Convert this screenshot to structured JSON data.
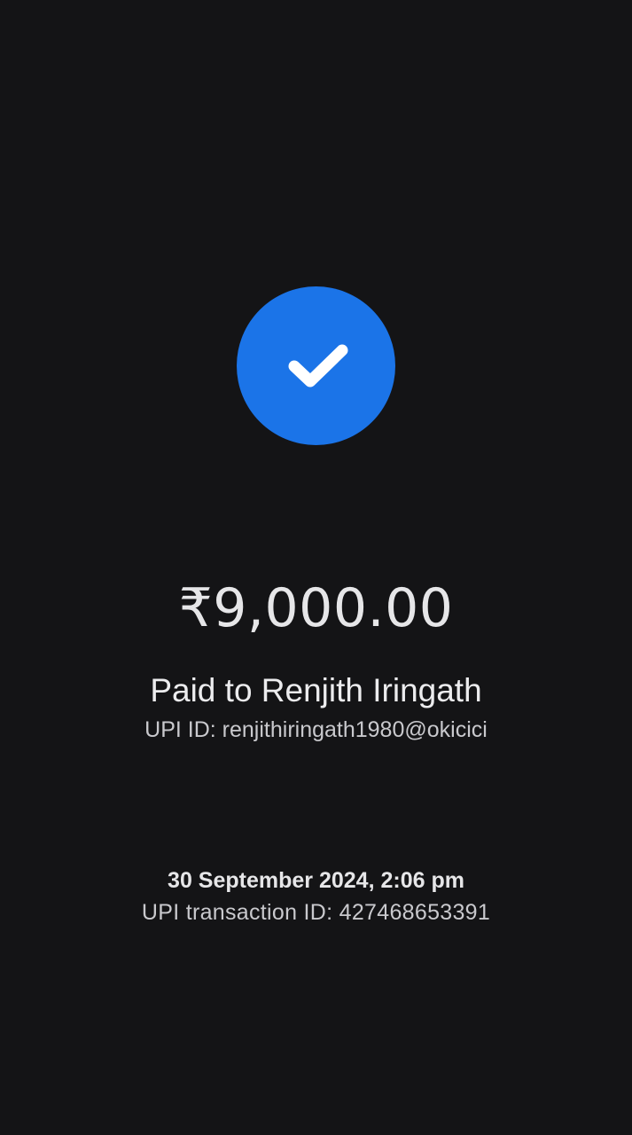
{
  "colors": {
    "background": "#141416",
    "success_circle": "#1b74e8",
    "check_mark": "#ffffff",
    "primary_text": "#e6e6e8",
    "secondary_text": "#c9c9cd"
  },
  "status": {
    "icon": "checkmark-icon"
  },
  "payment": {
    "amount": "₹9,000.00",
    "paid_to": "Paid to Renjith Iringath",
    "upi_id": "UPI ID: renjithiringath1980@okicici",
    "datetime": "30 September 2024, 2:06 pm",
    "transaction_id": "UPI transaction ID: 427468653391"
  }
}
